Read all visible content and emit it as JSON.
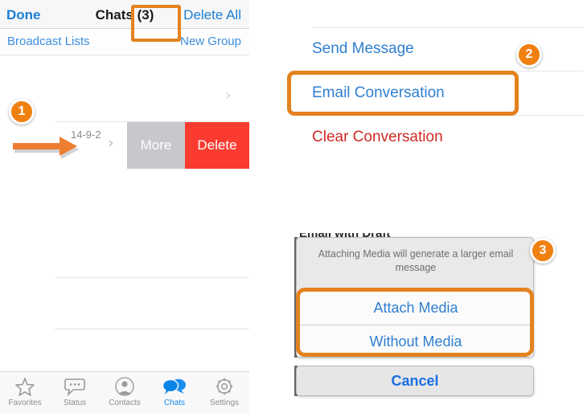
{
  "left_panel": {
    "navbar": {
      "done_label": "Done",
      "title": "Chats (3)",
      "delete_all_label": "Delete All"
    },
    "subbar": {
      "broadcast_lists_label": "Broadcast Lists",
      "new_group_label": "New Group"
    },
    "swiped_row": {
      "date": "14-9-2",
      "more_label": "More",
      "delete_label": "Delete"
    },
    "tabbar": [
      {
        "label": "Favorites",
        "icon": "star-icon",
        "active": false
      },
      {
        "label": "Status",
        "icon": "status-bubble-icon",
        "active": false
      },
      {
        "label": "Contacts",
        "icon": "person-icon",
        "active": false
      },
      {
        "label": "Chats",
        "icon": "chats-bubbles-icon",
        "active": true
      },
      {
        "label": "Settings",
        "icon": "gear-icon",
        "active": false
      }
    ]
  },
  "right_menu": {
    "items": [
      {
        "label": "Send Message",
        "style": "primary"
      },
      {
        "label": "Email Conversation",
        "style": "primary"
      },
      {
        "label": "Clear Conversation",
        "style": "danger"
      }
    ]
  },
  "action_sheet": {
    "clipped_title": "Email with Draft",
    "message": "Attaching Media will generate a larger email message",
    "buttons": [
      {
        "label": "Attach Media"
      },
      {
        "label": "Without Media"
      }
    ],
    "cancel_label": "Cancel"
  },
  "step_badges": [
    {
      "number": "1"
    },
    {
      "number": "2"
    },
    {
      "number": "3"
    }
  ],
  "colors": {
    "accent_orange": "#e3821e",
    "badge_orange": "#f08010",
    "link_blue": "#2f7fd0",
    "danger_red": "#cf2a22",
    "delete_red": "#fb3b30",
    "more_gray": "#c8c7cc",
    "active_tab_blue": "#1a8cf0"
  }
}
